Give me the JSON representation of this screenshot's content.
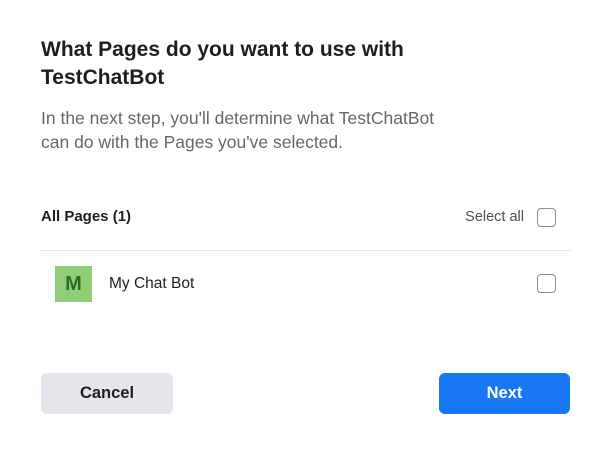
{
  "dialog": {
    "title": "What Pages do you want to use with TestChatBot",
    "subtitle_line1": "In the next step, you'll determine what TestChatBot",
    "subtitle_line2": "can do with the Pages you've selected."
  },
  "list": {
    "header_label": "All Pages (1)",
    "select_all_label": "Select all",
    "select_all_checked": false,
    "pages": [
      {
        "avatar_letter": "M",
        "avatar_color": "#8fce77",
        "name": "My Chat Bot",
        "checked": false
      }
    ]
  },
  "buttons": {
    "cancel_label": "Cancel",
    "next_label": "Next"
  },
  "colors": {
    "primary": "#1877f2",
    "secondary_button": "#e4e6eb",
    "subtitle_text": "#65676b"
  }
}
